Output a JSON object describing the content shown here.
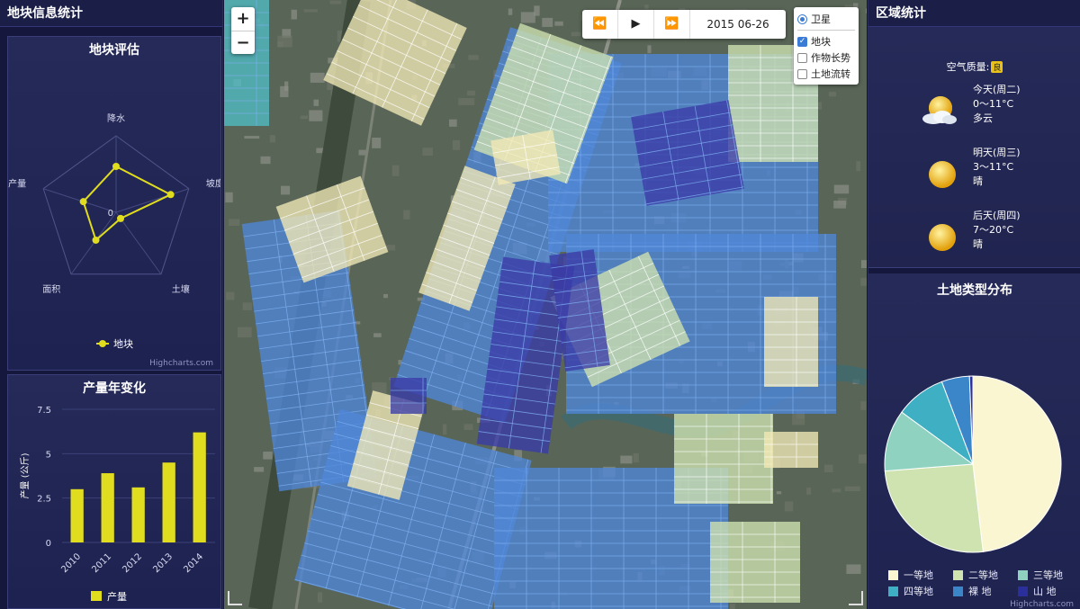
{
  "left_panel": {
    "title": "地块信息统计",
    "radar": {
      "title": "地块评估",
      "center_label": "0",
      "credit": "Highcharts.com"
    },
    "bar_card": {
      "title": "产量年变化",
      "credit": "Highcharts.com"
    }
  },
  "map": {
    "zoom_in": "+",
    "zoom_out": "−",
    "player": {
      "rewind": "⏪",
      "play": "▶",
      "forward": "⏩",
      "date": "2015 06-26"
    },
    "layers": {
      "base": "卫星",
      "overlays": [
        {
          "label": "地块",
          "checked": true
        },
        {
          "label": "作物长势",
          "checked": false
        },
        {
          "label": "土地流转",
          "checked": false
        }
      ]
    },
    "colors": {
      "parcel_cream": "#f2e9b6",
      "parcel_green": "#cfe3b0",
      "parcel_blue": "#4f87d8",
      "parcel_navy": "#3a3ba8",
      "parcel_teal": "#4fbcc4"
    }
  },
  "right_panel": {
    "title": "区域统计",
    "air_quality_label": "空气质量:",
    "air_quality_value": "良",
    "forecast": [
      {
        "day": "今天(周二)",
        "temp": "0～11°C",
        "cond": "多云",
        "icon": "partly-cloudy-icon"
      },
      {
        "day": "明天(周三)",
        "temp": "3～11°C",
        "cond": "晴",
        "icon": "sun-icon"
      },
      {
        "day": "后天(周四)",
        "temp": "7～20°C",
        "cond": "晴",
        "icon": "sun-icon"
      }
    ],
    "more": "︾",
    "pie_card": {
      "title": "土地类型分布",
      "credit": "Highcharts.com"
    }
  },
  "chart_data": [
    {
      "type": "radar",
      "title": "地块评估",
      "categories": [
        "降水",
        "坡度",
        "土壤",
        "面积",
        "产量"
      ],
      "series": [
        {
          "name": "地块",
          "values": [
            0.6,
            0.75,
            0.1,
            0.45,
            0.45
          ]
        }
      ],
      "color": "#e0dc1e",
      "legend": "bottom"
    },
    {
      "type": "bar",
      "title": "产量年变化",
      "categories": [
        "2010",
        "2011",
        "2012",
        "2013",
        "2014"
      ],
      "series": [
        {
          "name": "产量",
          "values": [
            3.0,
            3.9,
            3.1,
            4.5,
            6.2
          ]
        }
      ],
      "ylabel": "产量 (公斤)",
      "yticks": [
        0,
        2.5,
        5,
        7.5
      ],
      "ylim": [
        0,
        7.5
      ],
      "color": "#e0dc1e",
      "legend": "bottom"
    },
    {
      "type": "pie",
      "title": "土地类型分布",
      "slices": [
        {
          "name": "一等地",
          "value": 47,
          "color": "#fbf6d2"
        },
        {
          "name": "二等地",
          "value": 25,
          "color": "#cfe3b0"
        },
        {
          "name": "三等地",
          "value": 11,
          "color": "#8fd2c0"
        },
        {
          "name": "四等地",
          "value": 9,
          "color": "#3fb0c4"
        },
        {
          "name": "裸 地",
          "value": 5,
          "color": "#3a86c8"
        },
        {
          "name": "山 地",
          "value": 0.6,
          "color": "#2a2f9c"
        }
      ],
      "legend": "bottom"
    }
  ]
}
